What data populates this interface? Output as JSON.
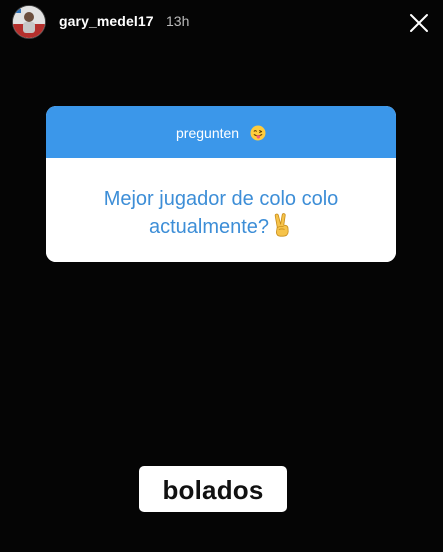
{
  "story": {
    "username": "gary_medel17",
    "time_ago": "13h"
  },
  "question_sticker": {
    "prompt": "pregunten",
    "prompt_emoji": "tongue-out-face-emoji",
    "answer_line1": "Mejor jugador de colo colo",
    "answer_line2": "actualmente?",
    "answer_emoji": "victory-hand-emoji",
    "header_color": "#3b97ea",
    "answer_color": "#3d8ed7"
  },
  "caption": {
    "text": "bolados"
  },
  "icons": {
    "avatar": "profile-avatar",
    "close": "close-icon"
  }
}
